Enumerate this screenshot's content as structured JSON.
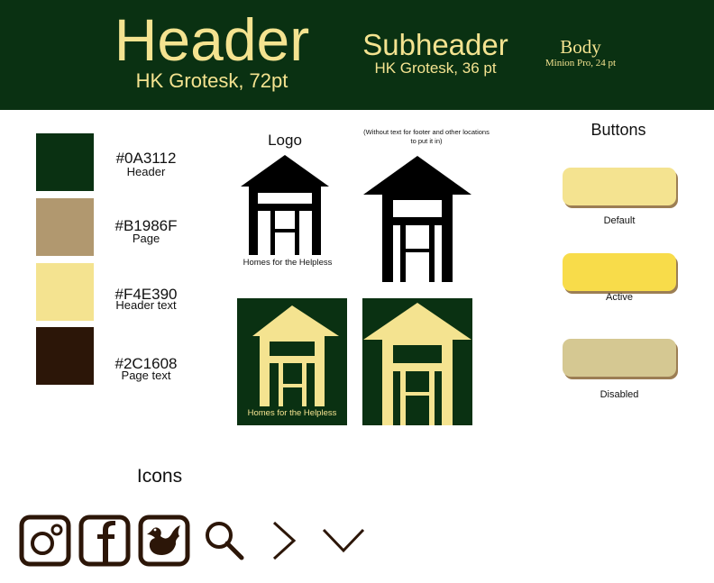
{
  "banner": {
    "header_title": "Header",
    "header_font": "HK Grotesk, 72pt",
    "subheader_title": "Subheader",
    "subheader_font": "HK Grotesk, 36 pt",
    "body_title": "Body",
    "body_font": "Minion Pro, 24 pt"
  },
  "palette": [
    {
      "hex": "#0A3112",
      "role": "Header"
    },
    {
      "hex": "#B1986F",
      "role": "Page"
    },
    {
      "hex": "#F4E390",
      "role": "Header text"
    },
    {
      "hex": "#2C1608",
      "role": "Page text"
    }
  ],
  "logo": {
    "title": "Logo",
    "note": "(Without text for footer and other locations to put it in)",
    "caption": "Homes  for the Helpless",
    "caption_dark": "Homes  for the Helpless",
    "ink_color": "#000000"
  },
  "buttons": {
    "title": "Buttons",
    "states": [
      {
        "label": "Default",
        "color": "#F4E390"
      },
      {
        "label": "Active",
        "color": "#F8DC4A"
      },
      {
        "label": "Disabled",
        "color": "#D5C892"
      }
    ]
  },
  "icons": {
    "title": "Icons",
    "items": [
      "instagram-icon",
      "facebook-icon",
      "bird-icon",
      "search-icon",
      "chevron-right-icon",
      "chevron-down-icon"
    ],
    "color": "#2C1608"
  }
}
